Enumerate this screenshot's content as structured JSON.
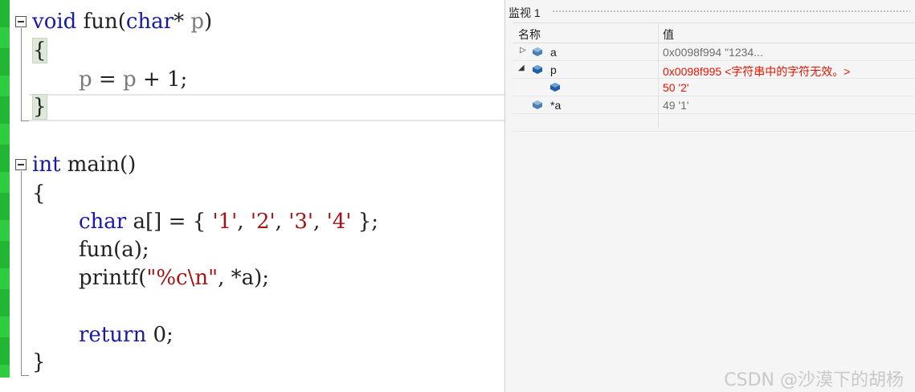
{
  "editor": {
    "lines": {
      "l1": {
        "kw": "void",
        "rest": " fun(",
        "kw2": "char",
        "rest2": "* ",
        "param": "p",
        "end": ")"
      },
      "l2": "{",
      "l3": {
        "a": "p",
        "b": " = ",
        "c": "p",
        "d": " + 1;"
      },
      "l4": "}",
      "l6": {
        "kw": "int",
        "rest": " main()"
      },
      "l7": "{",
      "l8": {
        "kw": "char",
        "p1": " a[] = { ",
        "c1": "'1'",
        "s1": ", ",
        "c2": "'2'",
        "s2": ", ",
        "c3": "'3'",
        "s3": ", ",
        "c4": "'4'",
        "end": " };"
      },
      "l9": "fun(a);",
      "l10": {
        "p1": "printf(",
        "str": "\"%c\\n\"",
        "p2": ", *a);"
      },
      "l12": {
        "kw": "return",
        "rest": " 0;"
      },
      "l13": "}"
    }
  },
  "watch": {
    "title": "监视 1",
    "columns": {
      "name": "名称",
      "value": "值"
    },
    "rows": [
      {
        "name": "a",
        "value": "0x0098f994 \"1234...",
        "expander": "▷"
      },
      {
        "name": "p",
        "value": "0x0098f995 <字符串中的字符无效。>",
        "expander": "◢"
      },
      {
        "name": "",
        "value": "50 '2'"
      },
      {
        "name": "*a",
        "value": "49 '1'"
      }
    ]
  },
  "watermark": "CSDN @沙漠下的胡杨",
  "colors": {
    "keyword": "#1a1aa6",
    "char_literal": "#a31515",
    "changed_value": "#e51400",
    "gutter": "#2ecc40"
  }
}
